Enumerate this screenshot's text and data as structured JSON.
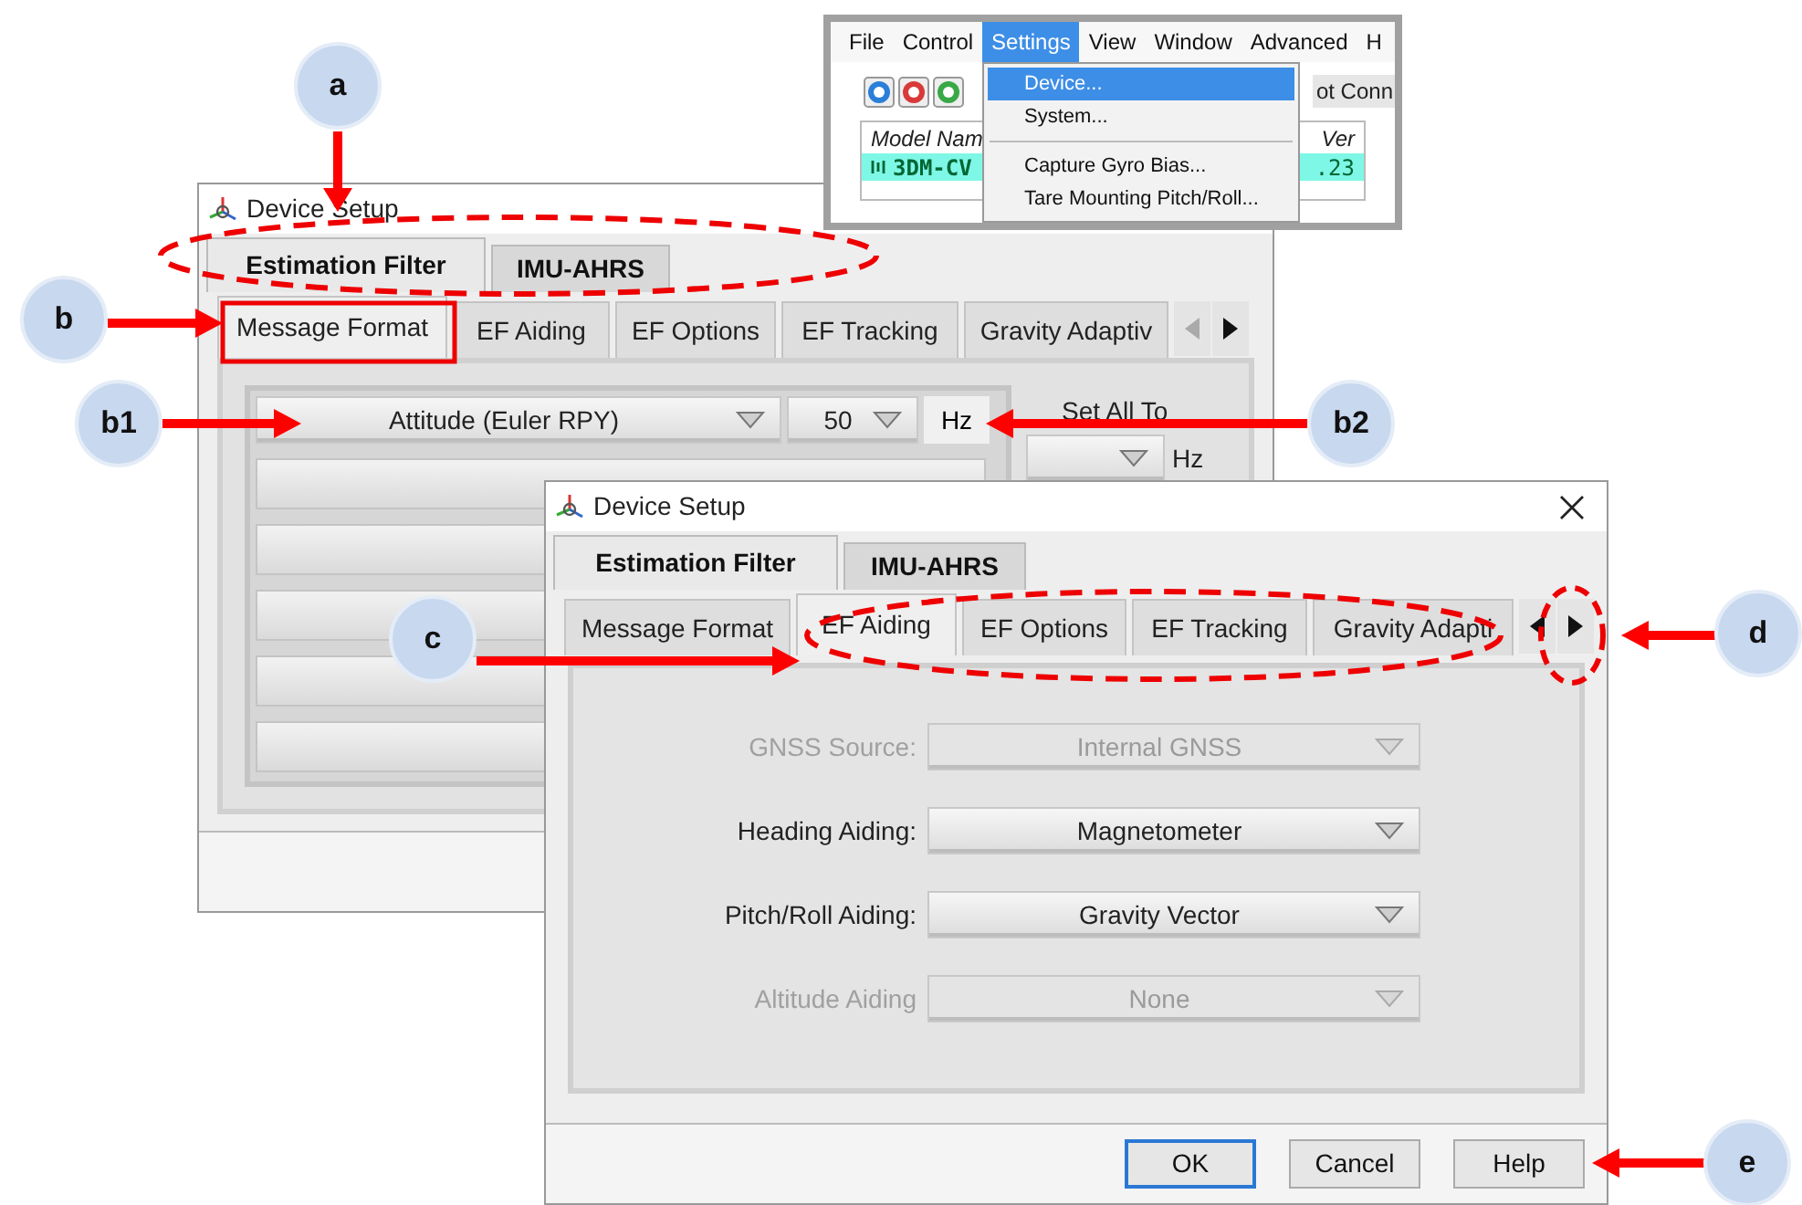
{
  "menu_window": {
    "menubar": [
      {
        "label": "File",
        "selected": false
      },
      {
        "label": "Control",
        "selected": false
      },
      {
        "label": "Settings",
        "selected": true
      },
      {
        "label": "View",
        "selected": false
      },
      {
        "label": "Window",
        "selected": false
      },
      {
        "label": "Advanced",
        "selected": false
      },
      {
        "label": "H",
        "selected": false
      }
    ],
    "menu": [
      {
        "kind": "item",
        "label": "Device...",
        "selected": true
      },
      {
        "kind": "item",
        "label": "System...",
        "selected": false
      },
      {
        "kind": "separator"
      },
      {
        "kind": "item",
        "label": "Capture Gyro Bias...",
        "selected": false
      },
      {
        "kind": "item",
        "label": "Tare Mounting Pitch/Roll...",
        "selected": false
      }
    ],
    "status": "ot Conn",
    "table": {
      "columns": [
        "Model Nam",
        "Ver"
      ],
      "rows": [
        {
          "cells": [
            "3DM-CV",
            ".23"
          ],
          "selected": true
        }
      ]
    }
  },
  "back_window": {
    "title": "Device Setup",
    "tabs": [
      {
        "label": "Estimation Filter",
        "selected": true
      },
      {
        "label": "IMU-AHRS",
        "selected": false
      }
    ],
    "subtabs": [
      {
        "label": "Message Format",
        "selected": true
      },
      {
        "label": "EF Aiding",
        "selected": false
      },
      {
        "label": "EF Options",
        "selected": false
      },
      {
        "label": "EF Tracking",
        "selected": false
      },
      {
        "label": "Gravity Adaptiv",
        "selected": false
      }
    ],
    "scroll_left_disabled": true,
    "rows": [
      {
        "message": "Attitude (Euler RPY)",
        "rate": "50",
        "unit": "Hz"
      }
    ],
    "set_all": {
      "label": "Set All To",
      "unit": "Hz"
    }
  },
  "front_window": {
    "title": "Device Setup",
    "tabs": [
      {
        "label": "Estimation Filter",
        "selected": true
      },
      {
        "label": "IMU-AHRS",
        "selected": false
      }
    ],
    "subtabs": [
      {
        "label": "Message Format",
        "selected": false
      },
      {
        "label": "EF Aiding",
        "selected": true
      },
      {
        "label": "EF Options",
        "selected": false
      },
      {
        "label": "EF Tracking",
        "selected": false
      },
      {
        "label": "Gravity Adapti",
        "selected": false
      }
    ],
    "scroll_left_disabled": false,
    "fields": [
      {
        "label": "GNSS Source:",
        "value": "Internal GNSS",
        "disabled": true
      },
      {
        "label": "Heading Aiding:",
        "value": "Magnetometer",
        "disabled": false
      },
      {
        "label": "Pitch/Roll Aiding:",
        "value": "Gravity Vector",
        "disabled": false
      },
      {
        "label": "Altitude Aiding",
        "value": "None",
        "disabled": true
      }
    ],
    "buttons": [
      {
        "label": "OK",
        "default": true
      },
      {
        "label": "Cancel",
        "default": false
      },
      {
        "label": "Help",
        "default": false
      }
    ]
  },
  "callouts": [
    {
      "label": "a"
    },
    {
      "label": "b"
    },
    {
      "label": "b1"
    },
    {
      "label": "b2"
    },
    {
      "label": "c"
    },
    {
      "label": "d"
    },
    {
      "label": "e"
    }
  ]
}
